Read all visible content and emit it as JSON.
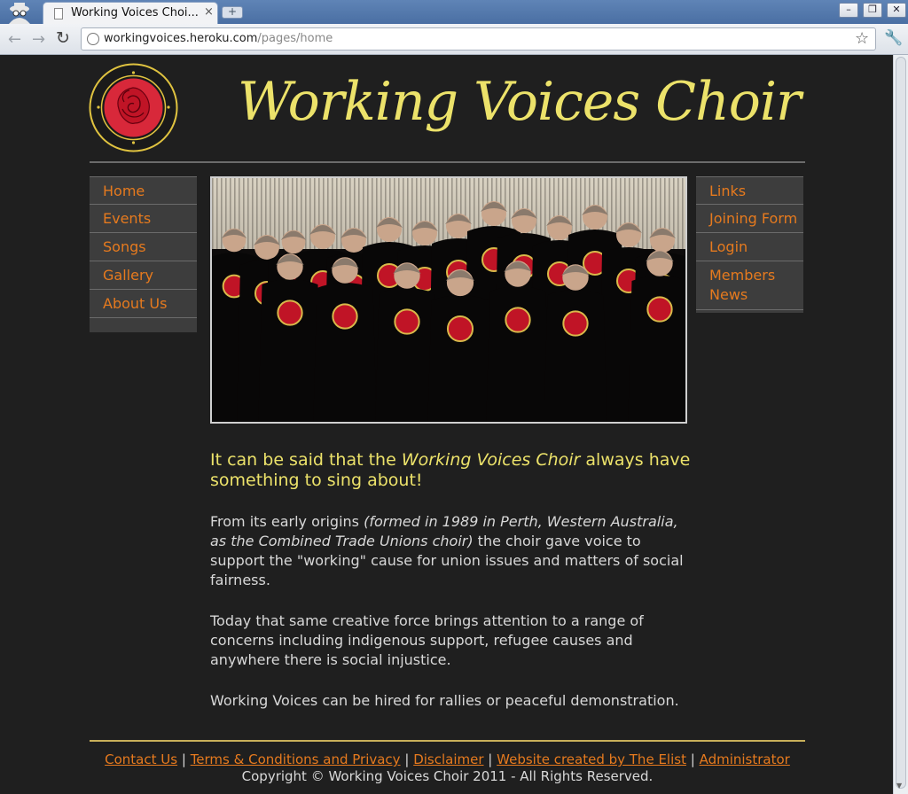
{
  "browser": {
    "tab_title": "Working Voices Choi...",
    "tab_close": "×",
    "new_tab": "+",
    "url_host": "workingvoices.heroku.com",
    "url_path": "/pages/home"
  },
  "header": {
    "site_title": "Working Voices Choir",
    "logo_text": "RIGHT TO WORK • RIGHT TO REST • RIGHT TO PLAY • RIGHTS FOR ALL"
  },
  "nav_left": [
    "Home",
    "Events",
    "Songs",
    "Gallery",
    "About Us"
  ],
  "nav_right": [
    "Links",
    "Joining Form",
    "Login",
    "Members News"
  ],
  "content": {
    "lead_before": "It can be said that the ",
    "lead_emphasis": "Working Voices Choir",
    "lead_after": " always have something to sing about!",
    "p1_before": "From its early origins ",
    "p1_emphasis": "(formed in 1989 in Perth, Western Australia, as the Combined Trade Unions choir)",
    "p1_after": " the choir gave voice to support the \"working\" cause for union issues and matters of social fairness.",
    "p2": "Today that same creative force brings attention to a range of concerns including indigenous support, refugee causes and anywhere there is social injustice.",
    "p3": "Working Voices can be hired for rallies or peaceful demonstration."
  },
  "footer": {
    "links": [
      "Contact Us",
      "Terms & Conditions and Privacy",
      "Disclaimer",
      "Website created by The Elist",
      "Administrator"
    ],
    "separator": "|",
    "copyright": "Copyright © Working Voices Choir 2011 - All Rights Reserved."
  },
  "colors": {
    "accent_orange": "#e67a1e",
    "title_yellow": "#ece26a",
    "page_bg": "#1f1f1f"
  }
}
